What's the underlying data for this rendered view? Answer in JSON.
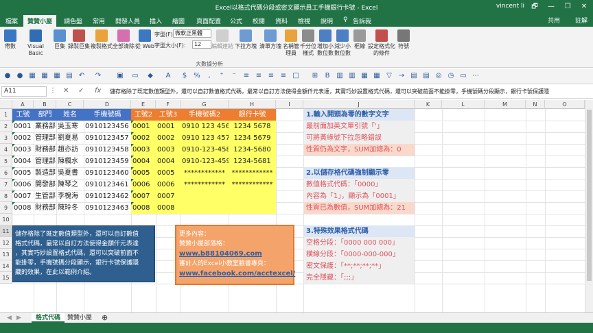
{
  "window": {
    "title": "Excel以格式代碼分段或密文顯示員工手機銀行卡號 - Excel",
    "user": "vincent li",
    "controls": [
      "🗗",
      "—",
      "❐",
      "✕"
    ]
  },
  "tabs": [
    {
      "label": "檔案"
    },
    {
      "label": "贊贊小屋"
    },
    {
      "label": "調色盤"
    },
    {
      "label": "常用"
    },
    {
      "label": "開發人員"
    },
    {
      "label": "插入"
    },
    {
      "label": "繪圖"
    },
    {
      "label": "頁面配置"
    },
    {
      "label": "公式"
    },
    {
      "label": "校閱"
    },
    {
      "label": "資料"
    },
    {
      "label": "檢視"
    },
    {
      "label": "說明"
    },
    {
      "label": "♀"
    },
    {
      "label": "告訴我"
    }
  ],
  "share_label": "共用",
  "comment_label": "註解",
  "ribbon": {
    "buttons": [
      {
        "label": "帶數",
        "color": "#3a78c2"
      },
      {
        "label": "Visual Basic",
        "color": "#2f6db5"
      },
      {
        "label": "巨集",
        "color": "#5a8fd0"
      },
      {
        "label": "錄製巨集",
        "color": "#c0504d"
      },
      {
        "label": "複製格式",
        "color": "#e8a33c"
      },
      {
        "label": "全部清除",
        "color": "#d46fb0"
      },
      {
        "label": "從 Web",
        "color": "#3a78c2"
      }
    ],
    "font_label": "字型(F):",
    "font_value": "微軟正黑體",
    "size_label": "字型大小(F):",
    "size_value": "12",
    "buttons2": [
      {
        "label": "編輯連結"
      },
      {
        "label": "下拉方塊"
      },
      {
        "label": "清單方塊"
      },
      {
        "label": "名稱管理員"
      },
      {
        "label": "千分位樣式"
      },
      {
        "label": "增加小數位數"
      },
      {
        "label": "減少小數位數"
      },
      {
        "label": "框線"
      },
      {
        "label": "設定格式化的條件"
      },
      {
        "label": "符號"
      }
    ],
    "group_label": "大數據分析"
  },
  "namebox": "A11",
  "formula": "儲存格除了既定數值類型外，還可以自訂數值格式代碼，最常以自訂方法使得金額仟元表達，其實巧妙設置格式代碼，還可以突破前面不能掛零，手機號碼分段顯示，銀行卡號保護隱",
  "columns": [
    "A",
    "B",
    "C",
    "D",
    "E",
    "F",
    "G",
    "H",
    "I",
    "J",
    "K",
    "L",
    "M",
    "N",
    "O"
  ],
  "rows": [
    "1",
    "2",
    "3",
    "4",
    "5",
    "6",
    "7",
    "8",
    "9",
    "10",
    "11",
    "12",
    "13",
    "14",
    "15"
  ],
  "table_headers": [
    "工號",
    "部門",
    "姓名",
    "手機號碼",
    "工號2",
    "工號3",
    "手機號碼2",
    "銀行卡號"
  ],
  "table_rows": [
    [
      "0001",
      "業務部",
      "吳玉寒",
      "0910123456",
      "0001",
      "0001",
      "0910 123 456",
      "1234 5678"
    ],
    [
      "0002",
      "管理部",
      "劉夏易",
      "0910123457",
      "0002",
      "0002",
      "0910 123 457",
      "1234 5679"
    ],
    [
      "0003",
      "財務部",
      "趙亦訪",
      "0910123458",
      "0003",
      "0003",
      "0910-123-458",
      "1234-5680"
    ],
    [
      "0004",
      "管理部",
      "陳楓水",
      "0910123459",
      "0004",
      "0004",
      "0910-123-459",
      "1234-5681"
    ],
    [
      "0005",
      "製造部",
      "吳夏書",
      "0910123460",
      "0005",
      "0005",
      "************",
      "************"
    ],
    [
      "0006",
      "開發部",
      "陳琴之",
      "0910123461",
      "0006",
      "0006",
      "************",
      "************"
    ],
    [
      "0007",
      "生管部",
      "李槐海",
      "0910123462",
      "0007",
      "0007",
      "",
      ""
    ],
    [
      "0008",
      "財務部",
      "陳玲冬",
      "0910123463",
      "0008",
      "0008",
      "",
      ""
    ]
  ],
  "info1": {
    "title": "1.輸入開頭為零的數字文字",
    "lines": [
      "最前面加英文單引號「'」",
      "可將黃綠號下拉忽略錯誤",
      "性質仍為文字，SUM加總為：0"
    ]
  },
  "info2": {
    "title": "2.以儲存格代碼強制顯示零",
    "lines": [
      "數值格式代碼：「0000」",
      "內容為「1」，顯示為「0001」",
      "性質已為數值，SUM加總為：21"
    ]
  },
  "info3": {
    "title": "3.特殊效果格式代碼",
    "lines": [
      "空格分段：「0000 000 000」",
      "橫線分段：「0000-000-000」",
      "密文保護：「**;**;**;**」",
      "完全隱藏：「;;;」"
    ]
  },
  "blue_box": [
    "儲存格除了既定數值類型外，還可以自訂數值",
    "格式代碼，最常以自訂方法使得金額仟元表達",
    "，其實巧妙設置格式代碼，還可以突破前面不",
    "能掛零，手機號碼分段顯示，銀行卡號保護隱",
    "藏的效果，在此以範例介紹。"
  ],
  "orange_box": {
    "line1": "更多內容：",
    "line2": "贊贊小屋部落格：",
    "link1": "www.b88104069.com",
    "line3": "審計人的Excel小教室臉書專頁：",
    "link2": "www.facebook.com/acctexcel/"
  },
  "sheets": [
    {
      "label": "格式代碼"
    },
    {
      "label": "贊贊小屋"
    }
  ],
  "add_sheet": "⊕",
  "colors": {
    "green": "#217346",
    "orange": "#ed7d31",
    "yellow": "#ffff66",
    "blue_fill": "#2e74b5",
    "header_blue": "#4472c4"
  }
}
